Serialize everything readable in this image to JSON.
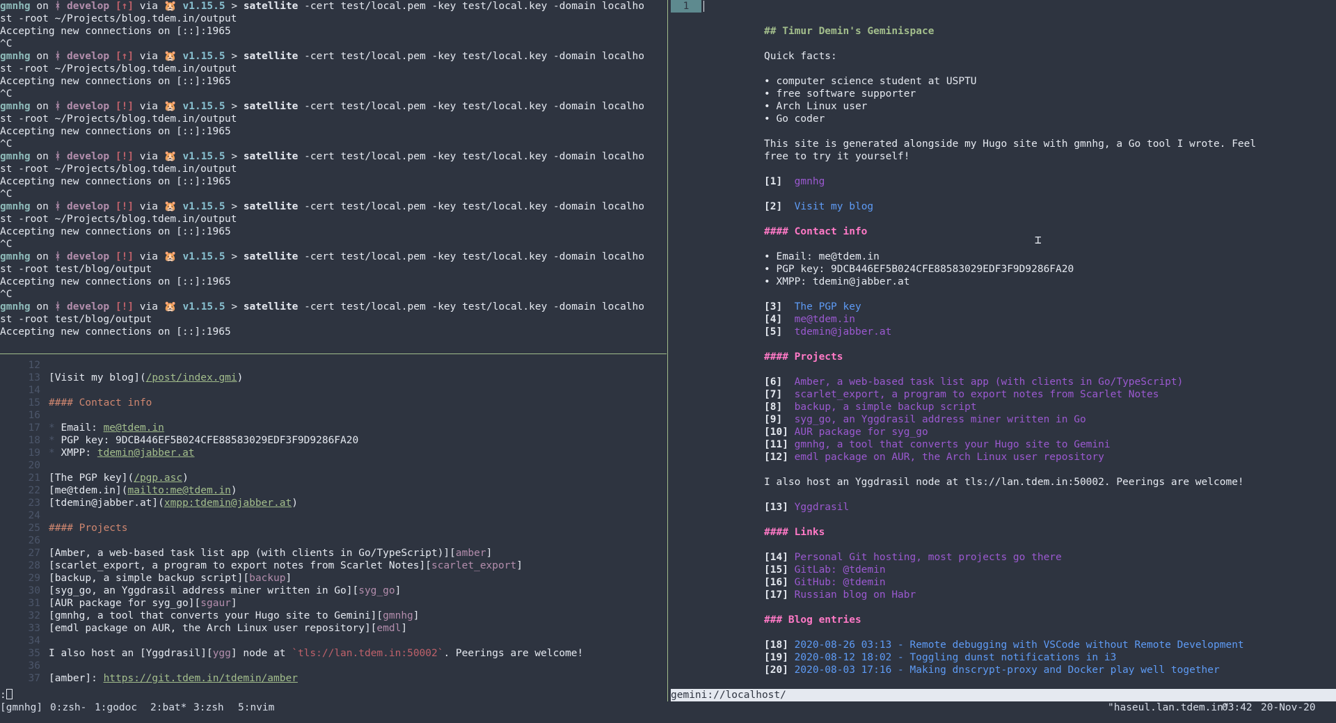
{
  "terminal": {
    "prompt": {
      "user": "gmnhg",
      "on": " on ",
      "branch_icon": "ᚼ",
      "branch": "develop",
      "via": " via ",
      "go_icon": "🐹",
      "version": "v1.15.5",
      "arrow": ">"
    },
    "blocks": [
      {
        "status": "[↑]",
        "cmd1": "satellite",
        "cmd_rest": " -cert test/local.pem -key test/local.key -domain localho",
        "wrap": "st -root ~/Projects/blog.tdem.in/output",
        "output": "Accepting new connections on [::]:1965",
        "interrupt": "^C"
      },
      {
        "status": "[↑]",
        "cmd1": "satellite",
        "cmd_rest": " -cert test/local.pem -key test/local.key -domain localho",
        "wrap": "st -root ~/Projects/blog.tdem.in/output",
        "output": "Accepting new connections on [::]:1965",
        "interrupt": "^C"
      },
      {
        "status": "[!]",
        "cmd1": "satellite",
        "cmd_rest": " -cert test/local.pem -key test/local.key -domain localho",
        "wrap": "st -root ~/Projects/blog.tdem.in/output",
        "output": "Accepting new connections on [::]:1965",
        "interrupt": "^C"
      },
      {
        "status": "[!]",
        "cmd1": "satellite",
        "cmd_rest": " -cert test/local.pem -key test/local.key -domain localho",
        "wrap": "st -root ~/Projects/blog.tdem.in/output",
        "output": "Accepting new connections on [::]:1965",
        "interrupt": "^C"
      },
      {
        "status": "[!]",
        "cmd1": "satellite",
        "cmd_rest": " -cert test/local.pem -key test/local.key -domain localho",
        "wrap": "st -root ~/Projects/blog.tdem.in/output",
        "output": "Accepting new connections on [::]:1965",
        "interrupt": "^C"
      },
      {
        "status": "[!]",
        "cmd1": "satellite",
        "cmd_rest": " -cert test/local.pem -key test/local.key -domain localho",
        "wrap": "st -root test/blog/output",
        "output": "Accepting new connections on [::]:1965",
        "interrupt": "^C"
      },
      {
        "status": "[!]",
        "cmd1": "satellite",
        "cmd_rest": " -cert test/local.pem -key test/local.key -domain localho",
        "wrap": "st -root test/blog/output",
        "output": "Accepting new connections on [::]:1965",
        "interrupt": ""
      }
    ]
  },
  "editor": {
    "lines": [
      {
        "n": "12",
        "parts": []
      },
      {
        "n": "13",
        "parts": [
          [
            "t",
            "[Visit my blog]("
          ],
          [
            "link",
            "/post/index.gmi"
          ],
          [
            "t",
            ")"
          ]
        ]
      },
      {
        "n": "14",
        "parts": []
      },
      {
        "n": "15",
        "parts": [
          [
            "h",
            "#### Contact info"
          ]
        ]
      },
      {
        "n": "16",
        "parts": []
      },
      {
        "n": "17",
        "parts": [
          [
            "b",
            "* "
          ],
          [
            "t",
            "Email: "
          ],
          [
            "link",
            "me@tdem.in"
          ]
        ]
      },
      {
        "n": "18",
        "parts": [
          [
            "b",
            "* "
          ],
          [
            "t",
            "PGP key: 9DCB446EF5B024CFE88583029EDF3F9D9286FA20"
          ]
        ]
      },
      {
        "n": "19",
        "parts": [
          [
            "b",
            "* "
          ],
          [
            "t",
            "XMPP: "
          ],
          [
            "link",
            "tdemin@jabber.at"
          ]
        ]
      },
      {
        "n": "20",
        "parts": []
      },
      {
        "n": "21",
        "parts": [
          [
            "t",
            "[The PGP key]("
          ],
          [
            "link",
            "/pgp.asc"
          ],
          [
            "t",
            ")"
          ]
        ]
      },
      {
        "n": "22",
        "parts": [
          [
            "t",
            "[me@tdem.in]("
          ],
          [
            "link",
            "mailto:me@tdem.in"
          ],
          [
            "t",
            ")"
          ]
        ]
      },
      {
        "n": "23",
        "parts": [
          [
            "t",
            "[tdemin@jabber.at]("
          ],
          [
            "link",
            "xmpp:tdemin@jabber.at"
          ],
          [
            "t",
            ")"
          ]
        ]
      },
      {
        "n": "24",
        "parts": []
      },
      {
        "n": "25",
        "parts": [
          [
            "h",
            "#### Projects"
          ]
        ]
      },
      {
        "n": "26",
        "parts": []
      },
      {
        "n": "27",
        "parts": [
          [
            "t",
            "[Amber, a web-based task list app (with clients in Go/TypeScript)]["
          ],
          [
            "r",
            "amber"
          ],
          [
            "t",
            "]"
          ]
        ]
      },
      {
        "n": "28",
        "parts": [
          [
            "t",
            "[scarlet_export, a program to export notes from Scarlet Notes]["
          ],
          [
            "r",
            "scarlet_export"
          ],
          [
            "t",
            "]"
          ]
        ]
      },
      {
        "n": "29",
        "parts": [
          [
            "t",
            "[backup, a simple backup script]["
          ],
          [
            "r",
            "backup"
          ],
          [
            "t",
            "]"
          ]
        ]
      },
      {
        "n": "30",
        "parts": [
          [
            "t",
            "[syg_go, an Yggdrasil address miner written in Go]["
          ],
          [
            "r",
            "syg_go"
          ],
          [
            "t",
            "]"
          ]
        ]
      },
      {
        "n": "31",
        "parts": [
          [
            "t",
            "[AUR package for syg_go]["
          ],
          [
            "r",
            "sgaur"
          ],
          [
            "t",
            "]"
          ]
        ]
      },
      {
        "n": "32",
        "parts": [
          [
            "t",
            "[gmnhg, a tool that converts your Hugo site to Gemini]["
          ],
          [
            "r",
            "gmnhg"
          ],
          [
            "t",
            "]"
          ]
        ]
      },
      {
        "n": "33",
        "parts": [
          [
            "t",
            "[emdl package on AUR, the Arch Linux user repository]["
          ],
          [
            "r",
            "emdl"
          ],
          [
            "t",
            "]"
          ]
        ]
      },
      {
        "n": "34",
        "parts": []
      },
      {
        "n": "35",
        "parts": [
          [
            "t",
            "I also host an [Yggdrasil]["
          ],
          [
            "r",
            "ygg"
          ],
          [
            "t",
            "] node at "
          ],
          [
            "c",
            "`tls://lan.tdem.in:50002`"
          ],
          [
            "t",
            ". Peerings are welcome!"
          ]
        ]
      },
      {
        "n": "36",
        "parts": []
      },
      {
        "n": "37",
        "parts": [
          [
            "t",
            "[amber]: "
          ],
          [
            "link",
            "https://git.tdem.in/tdemin/amber"
          ]
        ]
      }
    ],
    "cmdline": ":"
  },
  "gemini": {
    "tab_number": "1",
    "url": "gemini://localhost/",
    "lines": [
      [
        "h2",
        "## Timur Demin's Geminispace"
      ],
      [
        "blank",
        ""
      ],
      [
        "t",
        "Quick facts:"
      ],
      [
        "blank",
        ""
      ],
      [
        "t",
        "• computer science student at USPTU"
      ],
      [
        "t",
        "• free software supporter"
      ],
      [
        "t",
        "• Arch Linux user"
      ],
      [
        "t",
        "• Go coder"
      ],
      [
        "blank",
        ""
      ],
      [
        "t",
        "This site is generated alongside my Hugo site with gmnhg, a Go tool I wrote. Feel"
      ],
      [
        "t",
        "free to try it yourself!"
      ],
      [
        "blank",
        ""
      ],
      [
        "link",
        "[1]",
        "gmnhg",
        "local"
      ],
      [
        "blank",
        ""
      ],
      [
        "link",
        "[2]",
        "Visit my blog",
        "blue"
      ],
      [
        "blank",
        ""
      ],
      [
        "h4",
        "#### Contact info"
      ],
      [
        "blank",
        ""
      ],
      [
        "t",
        "• Email: me@tdem.in"
      ],
      [
        "t",
        "• PGP key: 9DCB446EF5B024CFE88583029EDF3F9D9286FA20"
      ],
      [
        "t",
        "• XMPP: tdemin@jabber.at"
      ],
      [
        "blank",
        ""
      ],
      [
        "link",
        "[3]",
        "The PGP key",
        "blue"
      ],
      [
        "link",
        "[4]",
        "me@tdem.in",
        "local"
      ],
      [
        "link",
        "[5]",
        "tdemin@jabber.at",
        "local"
      ],
      [
        "blank",
        ""
      ],
      [
        "h4",
        "#### Projects"
      ],
      [
        "blank",
        ""
      ],
      [
        "link",
        "[6]",
        "Amber, a web-based task list app (with clients in Go/TypeScript)",
        "local"
      ],
      [
        "link",
        "[7]",
        "scarlet_export, a program to export notes from Scarlet Notes",
        "local"
      ],
      [
        "link",
        "[8]",
        "backup, a simple backup script",
        "local"
      ],
      [
        "link",
        "[9]",
        "syg_go, an Yggdrasil address miner written in Go",
        "local"
      ],
      [
        "link",
        "[10]",
        "AUR package for syg_go",
        "local"
      ],
      [
        "link",
        "[11]",
        "gmnhg, a tool that converts your Hugo site to Gemini",
        "local"
      ],
      [
        "link",
        "[12]",
        "emdl package on AUR, the Arch Linux user repository",
        "local"
      ],
      [
        "blank",
        ""
      ],
      [
        "t",
        "I also host an Yggdrasil node at tls://lan.tdem.in:50002. Peerings are welcome!"
      ],
      [
        "blank",
        ""
      ],
      [
        "link",
        "[13]",
        "Yggdrasil",
        "local"
      ],
      [
        "blank",
        ""
      ],
      [
        "h4",
        "#### Links"
      ],
      [
        "blank",
        ""
      ],
      [
        "link",
        "[14]",
        "Personal Git hosting, most projects go there",
        "local"
      ],
      [
        "link",
        "[15]",
        "GitLab: @tdemin",
        "local"
      ],
      [
        "link",
        "[16]",
        "GitHub: @tdemin",
        "local"
      ],
      [
        "link",
        "[17]",
        "Russian blog on Habr",
        "local"
      ],
      [
        "blank",
        ""
      ],
      [
        "h4",
        "### Blog entries"
      ],
      [
        "blank",
        ""
      ],
      [
        "link",
        "[18]",
        "2020-08-26 03:13 - Remote debugging with VSCode without Remote Development",
        "blue"
      ],
      [
        "link",
        "[19]",
        "2020-08-12 18:02 - Toggling dunst notifications in i3",
        "blue"
      ],
      [
        "link",
        "[20]",
        "2020-08-03 17:16 - Making dnscrypt-proxy and Docker play well together",
        "blue"
      ]
    ]
  },
  "tmux": {
    "session": "[gmnhg]",
    "windows": [
      {
        "label": "0:zsh-"
      },
      {
        "label": "1:godoc"
      },
      {
        "label": "2:bat*"
      },
      {
        "label": "3:zsh"
      },
      {
        "label": "5:nvim"
      }
    ],
    "host": "\"haseul.lan.tdem.in\"",
    "time": "03:42",
    "date": "20-Nov-20"
  },
  "colors": {
    "background": "#2e3440",
    "separator": "#a3be8c",
    "heading_green": "#a3be8c",
    "heading_pink": "#ff79c6",
    "link_purple": "#9b59d0",
    "link_blue": "#5e9bf5",
    "md_heading": "#d08770"
  }
}
